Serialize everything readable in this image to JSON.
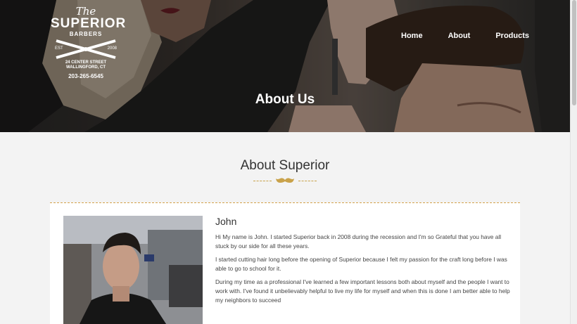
{
  "logo": {
    "the": "The",
    "superior": "SUPERIOR",
    "barbers": "BARBERS",
    "est": "EST",
    "year": "2008",
    "address_line1": "24 CENTER STREET",
    "address_line2": "WALLINGFORD, CT",
    "phone": "203-265-6545"
  },
  "nav": {
    "items": [
      {
        "label": "Home"
      },
      {
        "label": "About"
      },
      {
        "label": "Products"
      }
    ]
  },
  "hero": {
    "title": "About Us"
  },
  "section": {
    "title": "About Superior"
  },
  "profile": {
    "name": "John",
    "paragraphs": [
      "Hi My name is John. I started Superior back in 2008 during the recession and I'm so Grateful that you have all stuck by our side for all these years.",
      "I started cutting hair long before the opening of Superior because I felt my passion for the craft long before I was able to go to school for it.",
      "During my time as a professional I've learned a few important lessons both about myself and the people I want to work with. I've found it unbelievably helpful to live my life for myself and when this is done I am better able to help my neighbors to succeed"
    ]
  },
  "colors": {
    "accent_gold": "#c9a24a",
    "hero_overlay": "#000000",
    "background": "#f3f3f3"
  }
}
